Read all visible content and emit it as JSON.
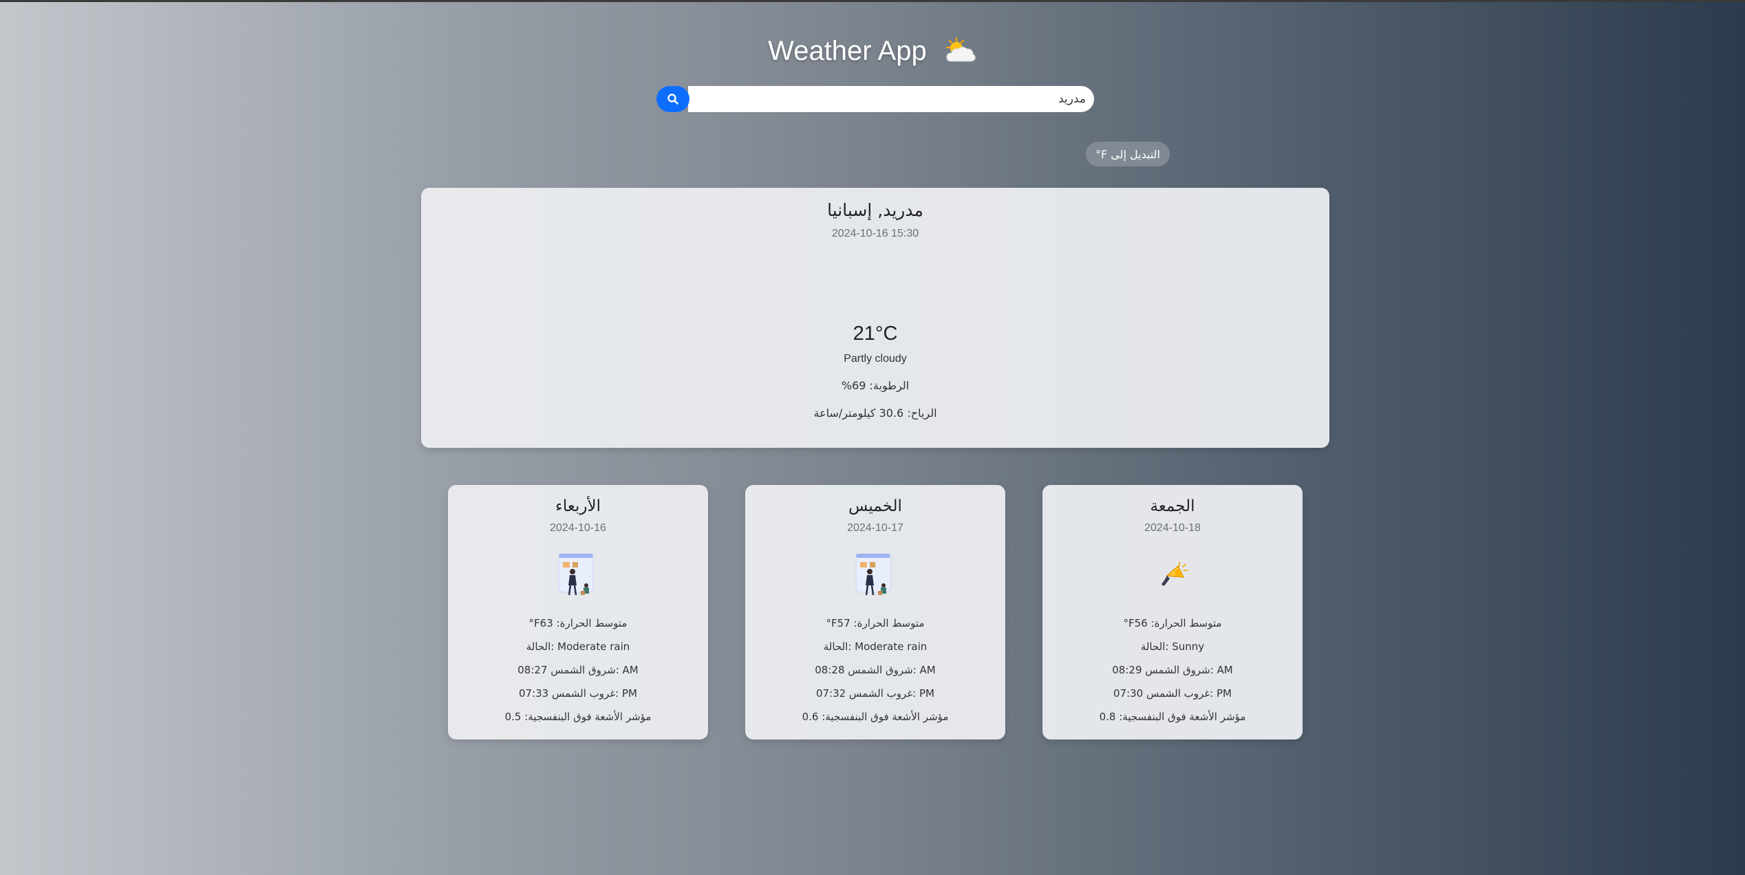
{
  "header": {
    "title": "Weather App",
    "icon": "sun-behind-cloud-icon"
  },
  "search": {
    "value": "مدريد",
    "button_icon": "search-icon"
  },
  "unit_toggle": {
    "label": "°F التبديل إلى"
  },
  "current": {
    "location": "مدريد, إسبانيا",
    "time": "2024-10-16 15:30",
    "temperature": "21°C",
    "condition": "Partly cloudy",
    "humidity": "%الرطوبة: 69",
    "wind": "الرياح: 30.6 كيلومتر/ساعة"
  },
  "forecast": [
    {
      "day": "الأربعاء",
      "date": "2024-10-16",
      "icon": "rain-illustration-icon",
      "avg_temp": "°Fمتوسط الحرارة: 63",
      "condition": "الحالة: Moderate rain",
      "sunrise": "08:27 شروق الشمس: AM",
      "sunset": "07:33 غروب الشمس: PM",
      "uv": "مؤشر الأشعة فوق البنفسجية: 0.5"
    },
    {
      "day": "الخميس",
      "date": "2024-10-17",
      "icon": "rain-illustration-icon",
      "avg_temp": "°Fمتوسط الحرارة: 57",
      "condition": "الحالة: Moderate rain",
      "sunrise": "08:28 شروق الشمس: AM",
      "sunset": "07:32 غروب الشمس: PM",
      "uv": "مؤشر الأشعة فوق البنفسجية: 0.6"
    },
    {
      "day": "الجمعة",
      "date": "2024-10-18",
      "icon": "sun-horn-icon",
      "avg_temp": "°Fمتوسط الحرارة: 56",
      "condition": "الحالة: Sunny",
      "sunrise": "08:29 شروق الشمس: AM",
      "sunset": "07:30 غروب الشمس: PM",
      "uv": "مؤشر الأشعة فوق البنفسجية: 0.8"
    }
  ],
  "colors": {
    "accent": "#0d6efd",
    "card": "#ebedf0",
    "bg_left": "#c2c7cc",
    "bg_right": "#2c3b4d"
  }
}
